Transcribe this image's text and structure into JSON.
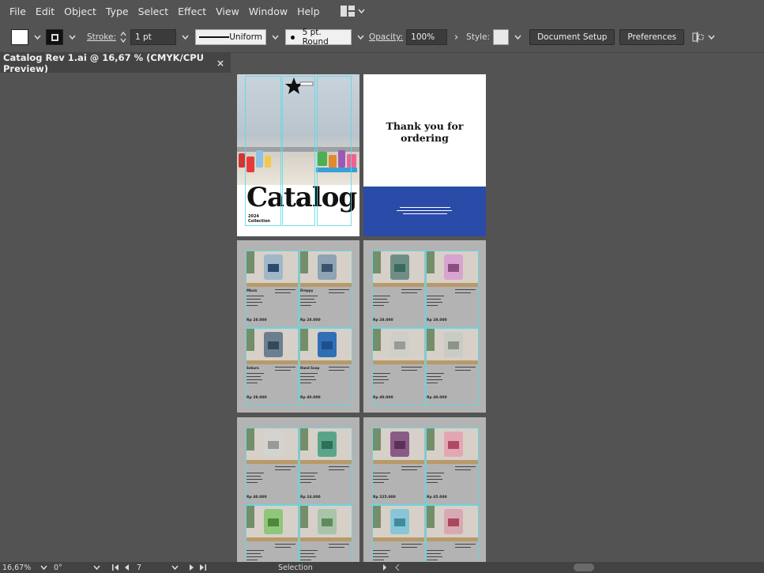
{
  "menu": [
    "File",
    "Edit",
    "Object",
    "Type",
    "Select",
    "Effect",
    "View",
    "Window",
    "Help"
  ],
  "control": {
    "stroke_label": "Stroke:",
    "stroke_weight": "1 pt",
    "profile": "Uniform",
    "brush": "5 pt. Round",
    "opacity_label": "Opacity:",
    "opacity": "100%",
    "style_label": "Style:",
    "document_setup": "Document Setup",
    "preferences": "Preferences"
  },
  "tab": {
    "title": "Catalog Rev 1.ai @ 16,67 % (CMYK/CPU Preview)",
    "close": "×"
  },
  "cover": {
    "title": "Catalog",
    "year": "2024",
    "subtitle": "Collection"
  },
  "back": {
    "thanks_line1": "Thank you for",
    "thanks_line2": "ordering"
  },
  "page2": {
    "products": [
      {
        "name": "Mbois",
        "price": "Rp 28.000",
        "jug": "#9fb7c9",
        "label": "#2b4a6e"
      },
      {
        "name": "Dreppy",
        "price": "Rp 28.000",
        "jug": "#8ea3b3",
        "label": "#3a5470"
      },
      {
        "name": "Sakura",
        "price": "Rp 28.000",
        "jug": "#6b7f8e",
        "label": "#34495e"
      },
      {
        "name": "Hand Soap",
        "price": "Rp 40.000",
        "jug": "#2f6fb5",
        "label": "#1f4f8a"
      }
    ]
  },
  "page3": {
    "products": [
      {
        "name": "",
        "price": "Rp 28.000",
        "jug": "#6f8f86",
        "label": "#3a6a5c"
      },
      {
        "name": "",
        "price": "Rp 28.000",
        "jug": "#d9a3cf",
        "label": "#8a4f80"
      },
      {
        "name": "",
        "price": "Rp 40.000",
        "jug": "#cfcfca",
        "label": "#9a9a92"
      },
      {
        "name": "",
        "price": "Rp 40.000",
        "jug": "#c9ccc4",
        "label": "#8d928a"
      }
    ]
  },
  "page4": {
    "products": [
      {
        "name": "",
        "price": "Rp 40.000",
        "jug": "#d3d3cf",
        "label": "#999"
      },
      {
        "name": "",
        "price": "Rp 24.000",
        "jug": "#5aa58a",
        "label": "#2f7059"
      },
      {
        "name": "",
        "price": "",
        "jug": "#8fc67b",
        "label": "#4a8a3a"
      },
      {
        "name": "",
        "price": "",
        "jug": "#a9c4a9",
        "label": "#5f8a5f"
      }
    ]
  },
  "page5": {
    "products": [
      {
        "name": "",
        "price": "Rp 225.000",
        "jug": "#8a5a86",
        "label": "#5a3058"
      },
      {
        "name": "",
        "price": "Rp 45.000",
        "jug": "#e3a7b3",
        "label": "#b04a63"
      },
      {
        "name": "",
        "price": "",
        "jug": "#88c6d6",
        "label": "#3f8aa0"
      },
      {
        "name": "",
        "price": "",
        "jug": "#d8a9b2",
        "label": "#a8485c"
      }
    ]
  },
  "status": {
    "zoom": "16,67%",
    "rotate": "0°",
    "artboard": "7",
    "tool": "Selection"
  },
  "colors": {
    "ui_bg": "#535353",
    "guide": "#5adce6",
    "blue_band": "#2b4ba8"
  }
}
